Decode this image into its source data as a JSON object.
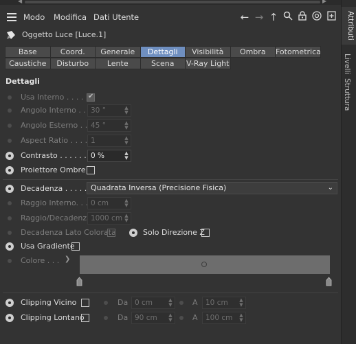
{
  "menu": {
    "items": [
      "Modo",
      "Modifica",
      "Dati Utente"
    ]
  },
  "object": {
    "title": "Oggetto Luce [Luce.1]"
  },
  "tabs": {
    "row1": [
      {
        "label": "Base",
        "active": false
      },
      {
        "label": "Coord.",
        "active": false
      },
      {
        "label": "Generale",
        "active": false
      },
      {
        "label": "Dettagli",
        "active": true
      },
      {
        "label": "Visibilità",
        "active": false
      },
      {
        "label": "Ombra",
        "active": false
      },
      {
        "label": "Fotometrica",
        "active": false
      }
    ],
    "row2": [
      {
        "label": "Caustiche",
        "active": false
      },
      {
        "label": "Disturbo",
        "active": false
      },
      {
        "label": "Lente",
        "active": false
      },
      {
        "label": "Scena",
        "active": false
      },
      {
        "label": "V-Ray Light",
        "active": false
      }
    ]
  },
  "section": {
    "title": "Dettagli"
  },
  "fields": {
    "usa_interno": {
      "label": "Usa Interno . . . . .",
      "checked": true
    },
    "angolo_interno": {
      "label": "Angolo Interno . .",
      "value": "30 °"
    },
    "angolo_esterno": {
      "label": "Angolo Esterno . .",
      "value": "45 °"
    },
    "aspect_ratio": {
      "label": "Aspect Ratio . . . .",
      "value": "1"
    },
    "contrasto": {
      "label": "Contrasto . . . . . .",
      "value": "0 %"
    },
    "proiettore_ombre": {
      "label": "Proiettore Ombre",
      "checked": false
    },
    "decadenza": {
      "label": "Decadenza . . . . . .",
      "value": "Quadrata Inversa (Precisione Fisica)"
    },
    "raggio_interno": {
      "label": "Raggio Interno. . .",
      "value": "0 cm"
    },
    "raggio_decadenza": {
      "label": "Raggio/Decadenza",
      "value": "1000 cm"
    },
    "decadenza_lato_colorata": {
      "label": "Decadenza Lato Colorata",
      "checked": false
    },
    "solo_direzione_z": {
      "label": "Solo Direzione Z",
      "checked": false
    },
    "usa_gradiente": {
      "label": "Usa Gradiente",
      "checked": false
    },
    "colore": {
      "label": "Colore . . ."
    },
    "clipping_vicino": {
      "label": "Clipping Vicino",
      "checked": false,
      "da_label": "Da",
      "da_value": "0 cm",
      "a_label": "A",
      "a_value": "10 cm"
    },
    "clipping_lontano": {
      "label": "Clipping Lontano",
      "checked": false,
      "da_label": "Da",
      "da_value": "90 cm",
      "a_label": "A",
      "a_value": "100 cm"
    }
  },
  "side_tabs": [
    "Attributi",
    "Livelli",
    "Struttura"
  ],
  "colors": {
    "active_tab": "#6f8fc0",
    "panel_bg": "#333333",
    "gradient": "#6d6d6d"
  }
}
